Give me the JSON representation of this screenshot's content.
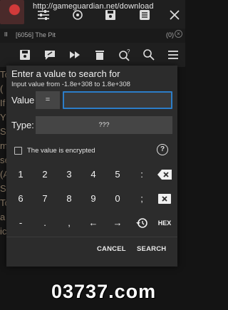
{
  "topbar": {
    "url": "http://gameguardian.net/download",
    "icons": [
      "app-icon",
      "sliders-icon",
      "target-icon",
      "save-icon",
      "list-icon",
      "close-icon"
    ]
  },
  "statusbar": {
    "pause": "II",
    "process": "[6056] The Pit",
    "count": "(0)"
  },
  "toolbar": {
    "icons": [
      "save-icon",
      "edit-icon",
      "fast-forward-icon",
      "trash-icon",
      "search-question-icon",
      "search-icon",
      "menu-icon"
    ]
  },
  "background": {
    "fragment": "To\n(\nIf\nY\nSe\nm\nse\n(A\nSe\nTo\na\nic"
  },
  "dialog": {
    "title": "Enter a value to search for",
    "subtitle": "Input value from -1.8e+308 to 1.8e+308",
    "value_label": "Value",
    "operator": "=",
    "value_input": "",
    "type_label": "Type:",
    "type_value": "???",
    "encrypted_label": "The value is encrypted",
    "encrypted_checked": false,
    "help": "?",
    "keys": {
      "row1": [
        "1",
        "2",
        "3",
        "4",
        "5",
        ":",
        "backspace-icon"
      ],
      "row2": [
        "6",
        "7",
        "8",
        "9",
        "0",
        ";",
        "clear-icon"
      ],
      "row3": [
        "-",
        ".",
        ",",
        "←",
        "→",
        "history-icon",
        "HEX"
      ]
    },
    "cancel": "CANCEL",
    "search": "SEARCH"
  },
  "watermark": "03737.com",
  "colors": {
    "accent": "#2c7dc8",
    "dialog_bg": "#2c2c2c",
    "bar_bg": "#1f1f1f"
  }
}
